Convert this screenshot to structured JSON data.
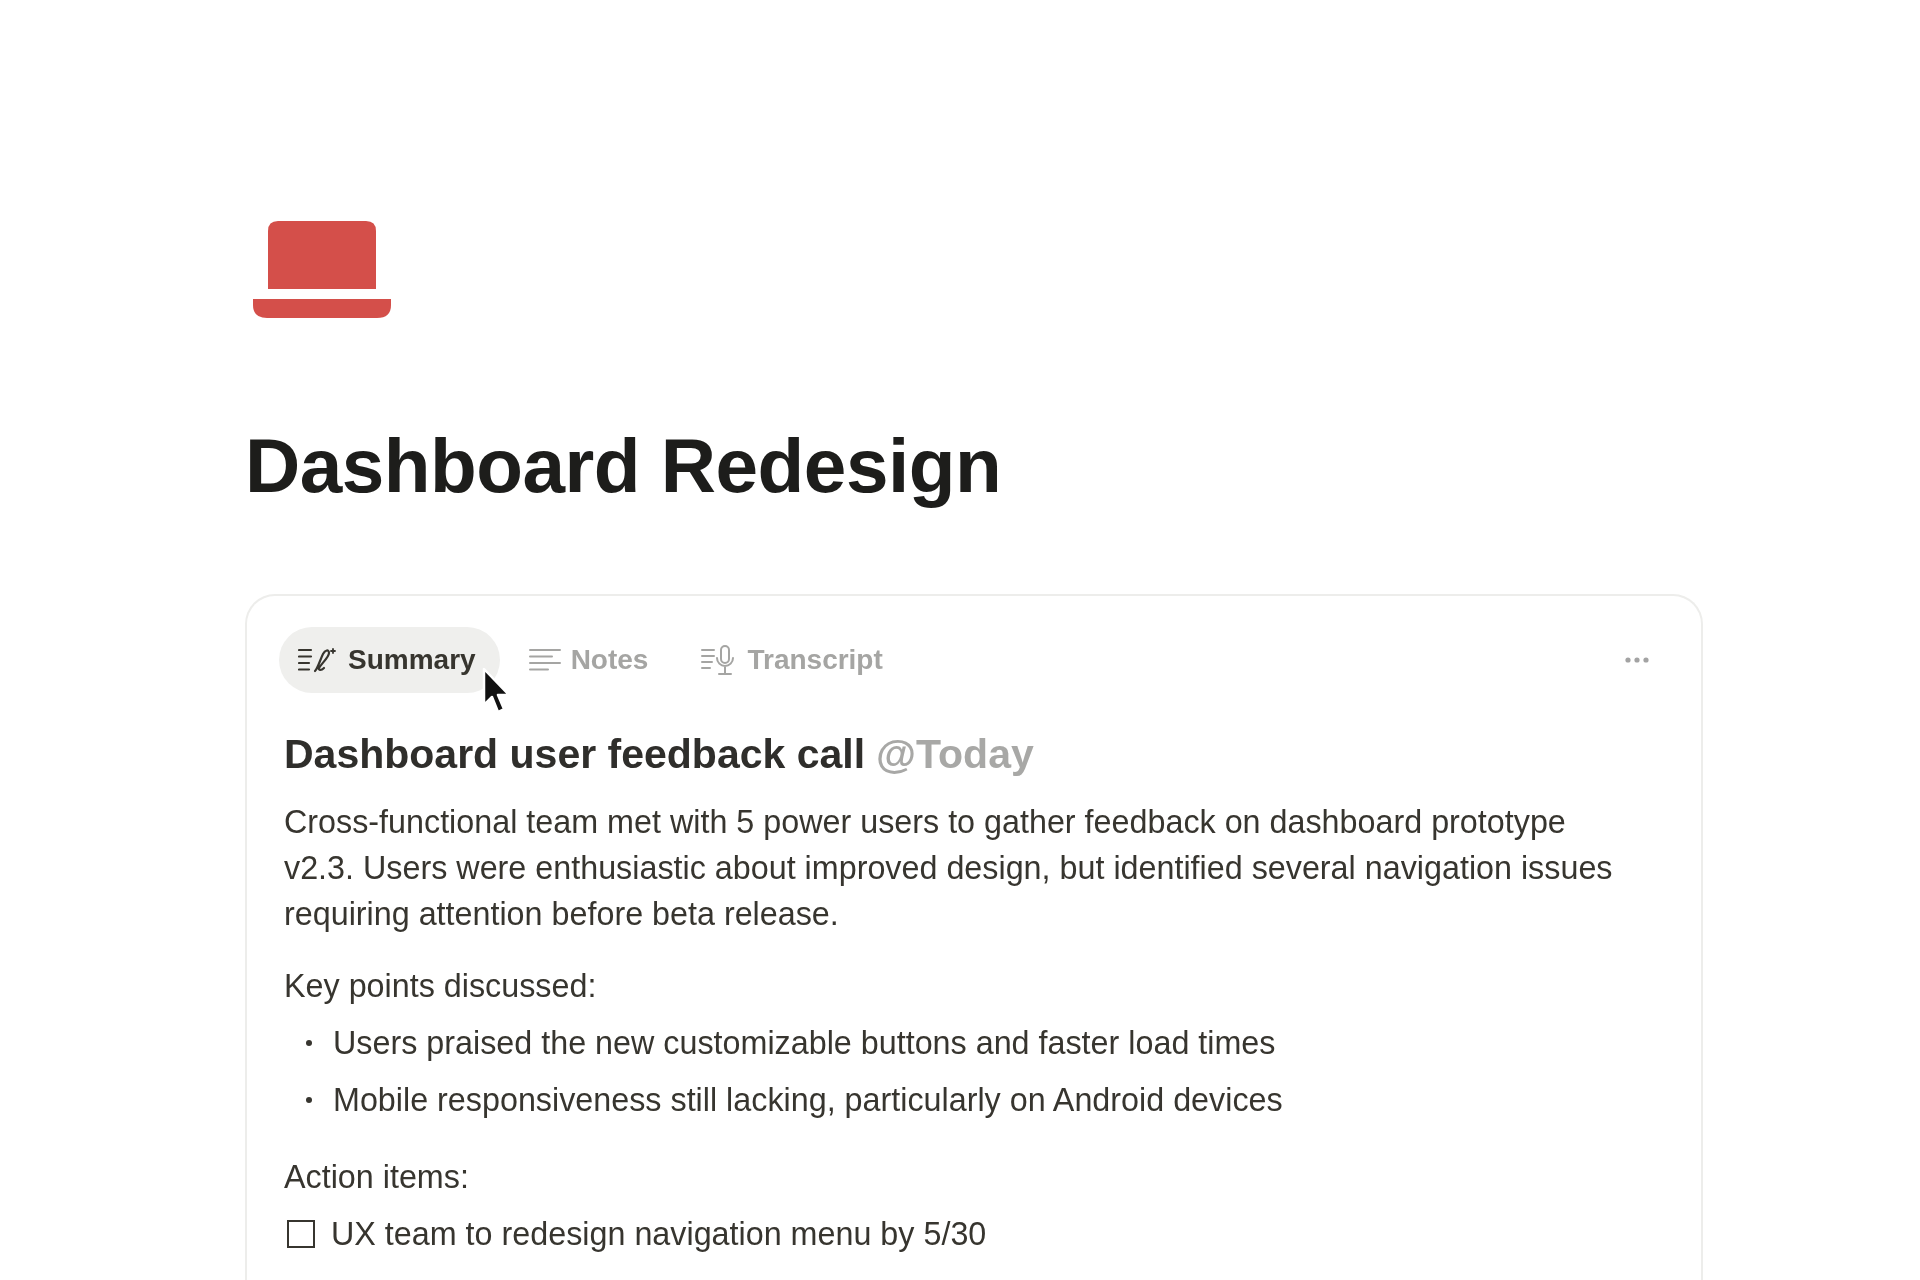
{
  "page": {
    "title": "Dashboard Redesign"
  },
  "meeting": {
    "tabs": [
      {
        "label": "Summary",
        "selected": true
      },
      {
        "label": "Notes",
        "selected": false
      },
      {
        "label": "Transcript",
        "selected": false
      }
    ],
    "heading": "Dashboard user feedback call",
    "date_mention": "@Today",
    "summary": "Cross-functional team met with 5 power users to gather feedback on dashboard prototype v2.3. Users were enthusiastic about improved design, but identified several navigation issues requiring attention before beta release.",
    "sections": [
      {
        "kind": "bullets",
        "heading": "Key points discussed:",
        "items": [
          {
            "text": "Users praised the new customizable buttons and faster load times"
          },
          {
            "text": "Mobile responsiveness still lacking, particularly on Android devices"
          }
        ]
      },
      {
        "kind": "todos",
        "heading": "Action items:",
        "items": [
          {
            "text": "UX team to redesign navigation menu by 5/30",
            "checked": false
          }
        ]
      }
    ]
  }
}
